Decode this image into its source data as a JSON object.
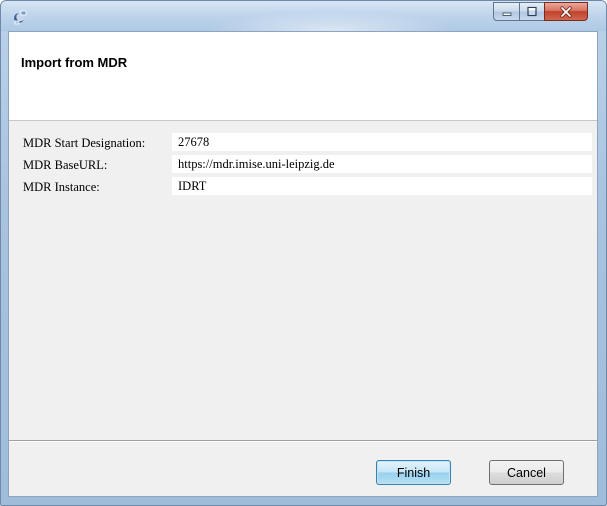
{
  "window": {
    "title": "",
    "icon": "eclipse-app-icon",
    "controls": {
      "minimize_icon": "minimize-icon",
      "maximize_icon": "maximize-icon",
      "close_icon": "close-icon"
    }
  },
  "header": {
    "title": "Import from MDR"
  },
  "form": {
    "fields": [
      {
        "label": "MDR Start Designation:",
        "value": "27678"
      },
      {
        "label": "MDR BaseURL:",
        "value": "https://mdr.imise.uni-leipzig.de"
      },
      {
        "label": "MDR Instance:",
        "value": "IDRT"
      }
    ]
  },
  "buttons": {
    "finish_label": "Finish",
    "cancel_label": "Cancel"
  },
  "colors": {
    "close_button": "#c8452f",
    "default_button_border": "#3c7fb1",
    "dialog_background": "#f0f0f0"
  }
}
